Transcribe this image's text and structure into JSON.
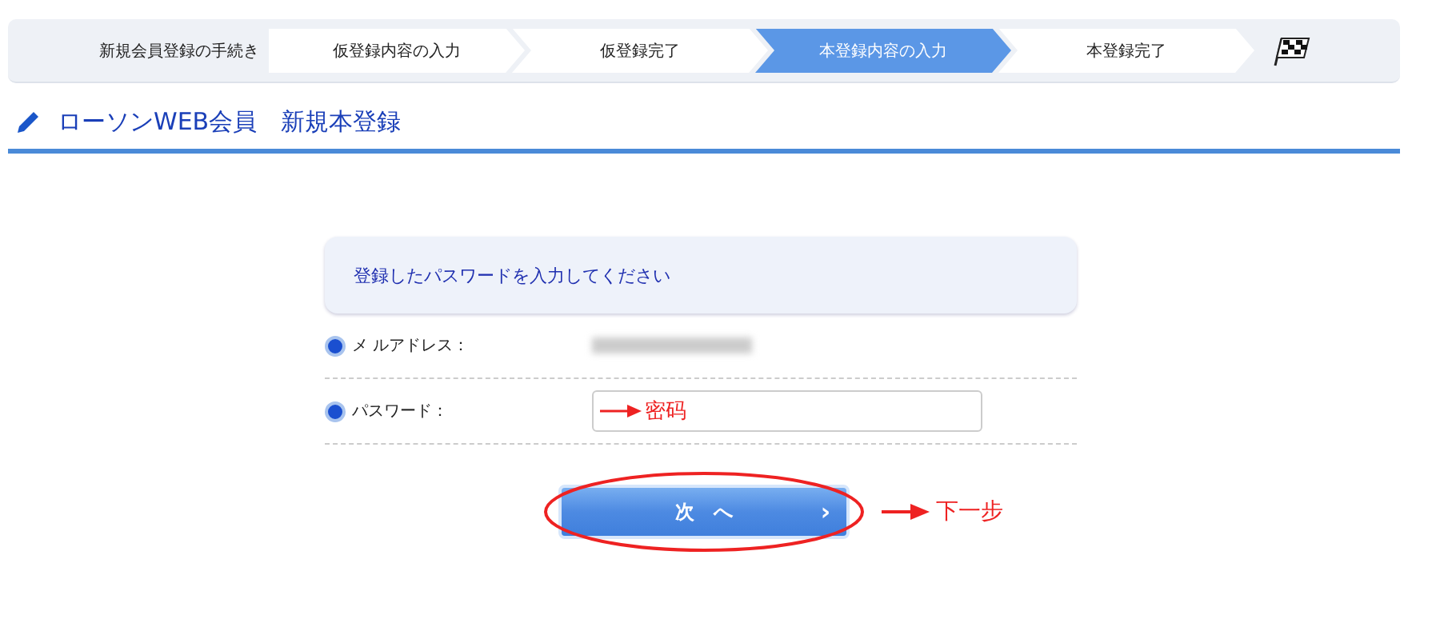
{
  "steps": {
    "label": "新規会員登録の手続き",
    "items": [
      {
        "label": "仮登録内容の入力",
        "selected": false
      },
      {
        "label": "仮登録完了",
        "selected": false
      },
      {
        "label": "本登録内容の入力",
        "selected": true
      },
      {
        "label": "本登録完了",
        "selected": false
      }
    ]
  },
  "heading": "ローソンWEB会員　新規本登録",
  "notice": "登録したパスワードを入力してください",
  "fields": [
    {
      "kind": "static",
      "label": "メ ルアドレス：",
      "checked": true
    },
    {
      "kind": "password",
      "label": "パスワード：",
      "checked": true,
      "annotation": "密码"
    }
  ],
  "next_button": {
    "label": "次　へ",
    "chevron": "›",
    "annotation": "下一步"
  }
}
